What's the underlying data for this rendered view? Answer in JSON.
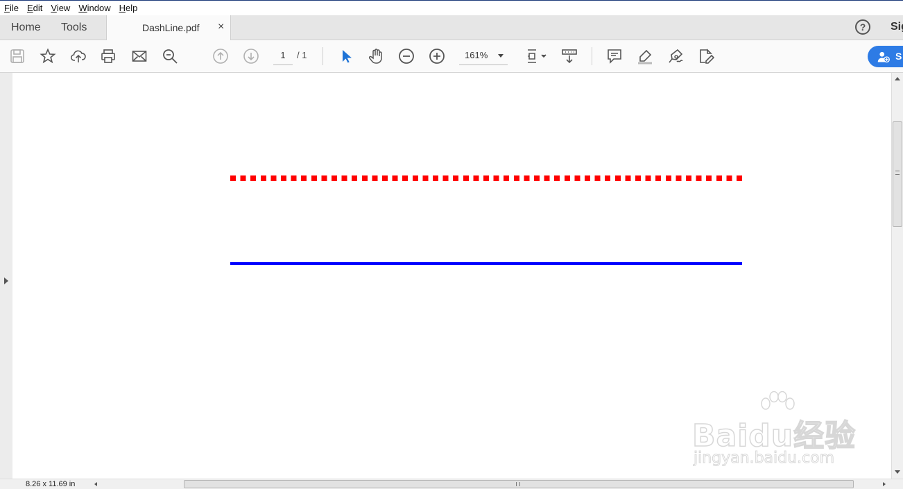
{
  "menu": {
    "items": [
      {
        "first": "F",
        "rest": "ile"
      },
      {
        "first": "E",
        "rest": "dit"
      },
      {
        "first": "V",
        "rest": "iew"
      },
      {
        "first": "W",
        "rest": "indow"
      },
      {
        "first": "H",
        "rest": "elp"
      }
    ]
  },
  "tabs": {
    "home": "Home",
    "tools": "Tools",
    "document": "DashLine.pdf",
    "close": "×"
  },
  "header": {
    "help": "?",
    "sign": "Sig"
  },
  "toolbar": {
    "page_current": "1",
    "page_total": "/ 1",
    "zoom": "161%",
    "share_label": "S"
  },
  "document": {
    "lines": [
      {
        "style": "dashed",
        "color": "#ff0000"
      },
      {
        "style": "solid",
        "color": "#0000ff"
      }
    ]
  },
  "status": {
    "page_size": "8.26 x 11.69 in"
  },
  "watermark": {
    "main": "Baidu经验",
    "sub": "jingyan.baidu.com"
  },
  "colors": {
    "accent": "#2d7be5",
    "select_tool": "#1e73d6"
  }
}
